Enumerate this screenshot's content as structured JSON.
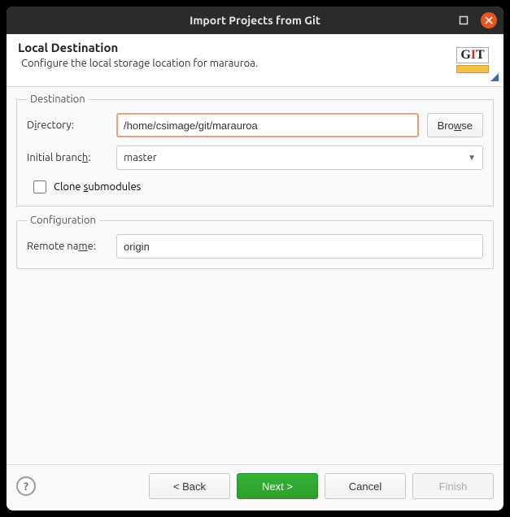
{
  "window": {
    "title": "Import Projects from Git"
  },
  "header": {
    "title": "Local Destination",
    "subtitle": "Configure the local storage location for marauroa."
  },
  "destination": {
    "legend": "Destination",
    "directory_pre": "D",
    "directory_u": "i",
    "directory_post": "rectory:",
    "directory_value": "/home/csimage/git/marauroa",
    "browse_pre": "Bro",
    "browse_u": "w",
    "browse_post": "se",
    "branch_pre": "Initial branc",
    "branch_u": "h",
    "branch_post": ":",
    "branch_value": "master",
    "clone_pre": "Clone ",
    "clone_u": "s",
    "clone_post": "ubmodules",
    "clone_checked": false
  },
  "config": {
    "legend": "Configuration",
    "remote_pre": "Remote na",
    "remote_u": "m",
    "remote_post": "e:",
    "remote_value": "origin"
  },
  "footer": {
    "help": "?",
    "back": "< Back",
    "next": "Next >",
    "cancel": "Cancel",
    "finish": "Finish"
  }
}
